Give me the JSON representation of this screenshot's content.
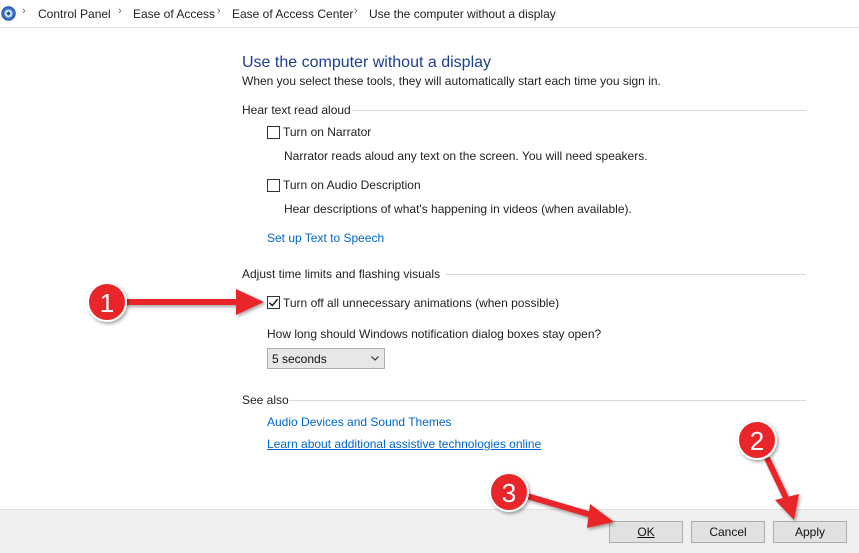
{
  "breadcrumb": {
    "items": [
      "Control Panel",
      "Ease of Access",
      "Ease of Access Center",
      "Use the computer without a display"
    ],
    "separator": ">"
  },
  "page": {
    "title": "Use the computer without a display",
    "subtitle": "When you select these tools, they will automatically start each time you sign in."
  },
  "sections": {
    "text_read_aloud": {
      "heading": "Hear text read aloud",
      "narrator_label": "Turn on Narrator",
      "narrator_checked": false,
      "narrator_desc": "Narrator reads aloud any text on the screen. You will need speakers.",
      "audio_desc_label": "Turn on Audio Description",
      "audio_desc_checked": false,
      "audio_desc_desc": "Hear descriptions of what's happening in videos (when available).",
      "tts_link": "Set up Text to Speech"
    },
    "time_limits": {
      "heading": "Adjust time limits and flashing visuals",
      "animations_label": "Turn off all unnecessary animations (when possible)",
      "animations_checked": true,
      "notification_question": "How long should Windows notification dialog boxes stay open?",
      "notification_value": "5 seconds"
    },
    "see_also": {
      "heading": "See also",
      "link1": "Audio Devices and Sound Themes",
      "link2": "Learn about additional assistive technologies online"
    }
  },
  "buttons": {
    "ok": "OK",
    "cancel": "Cancel",
    "apply": "Apply"
  },
  "annotations": {
    "badge1": "1",
    "badge2": "2",
    "badge3": "3",
    "color": "#e8262a"
  },
  "colors": {
    "title": "#1c3f94",
    "link": "#0066cc",
    "footer": "#f0f0f0"
  }
}
